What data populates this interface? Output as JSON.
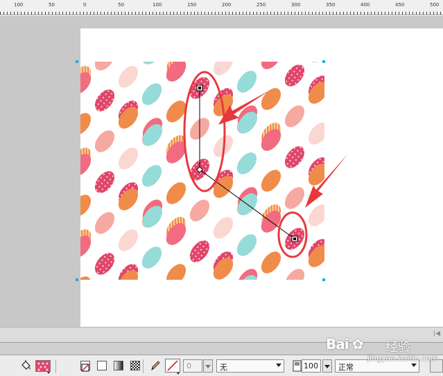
{
  "ruler": {
    "labels": [
      "100",
      "50",
      "0",
      "50",
      "100",
      "150",
      "200",
      "250",
      "300",
      "350",
      "400",
      "450",
      "500"
    ]
  },
  "annotation": {
    "color": "#e8383d"
  },
  "pattern": {
    "colors": [
      "#e0466a",
      "#f08c4a",
      "#3c9096",
      "#f6a9a0",
      "#7fd0cc",
      "#f7b27d",
      "#f26b80",
      "#fbd7d2"
    ]
  },
  "properties_bar": {
    "stroke_width": "0",
    "stroke_style": "无",
    "opacity": "100",
    "blend_mode": "正常"
  },
  "watermark": {
    "logo": "Bai",
    "logo_suffix": "经验",
    "url": "jingyan.baidu.com"
  }
}
